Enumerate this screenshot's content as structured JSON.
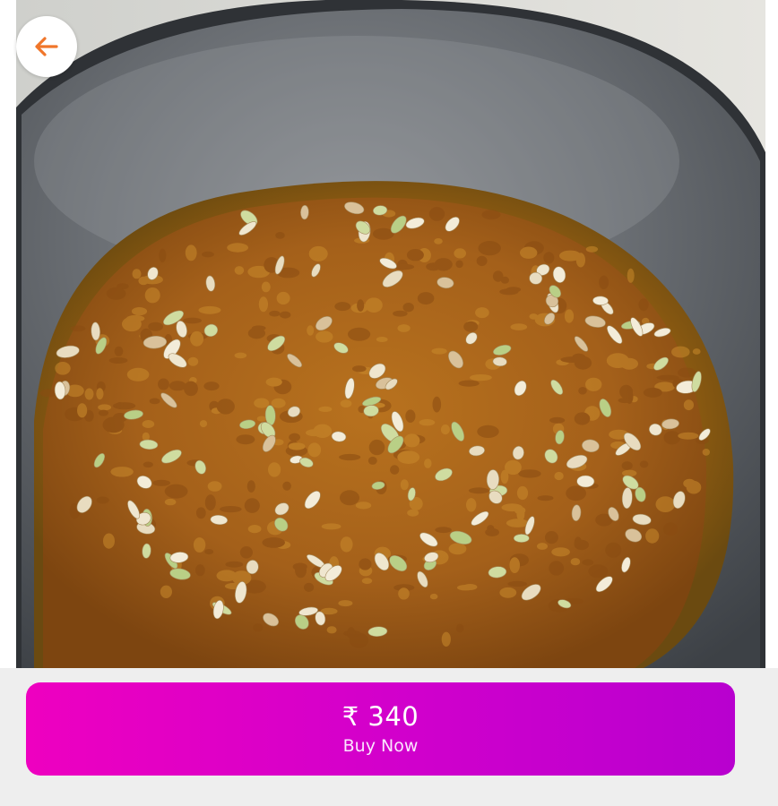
{
  "product": {
    "image": "halwa-in-steel-bowl-photo"
  },
  "header": {
    "back_icon": "arrow-left-icon"
  },
  "purchase": {
    "price": "₹ 340",
    "buy_label": "Buy Now"
  },
  "colors": {
    "accent_gradient_start": "#ee00c0",
    "accent_gradient_end": "#b800cf",
    "back_arrow": "#f0762a",
    "page_background": "#eeeeee"
  }
}
